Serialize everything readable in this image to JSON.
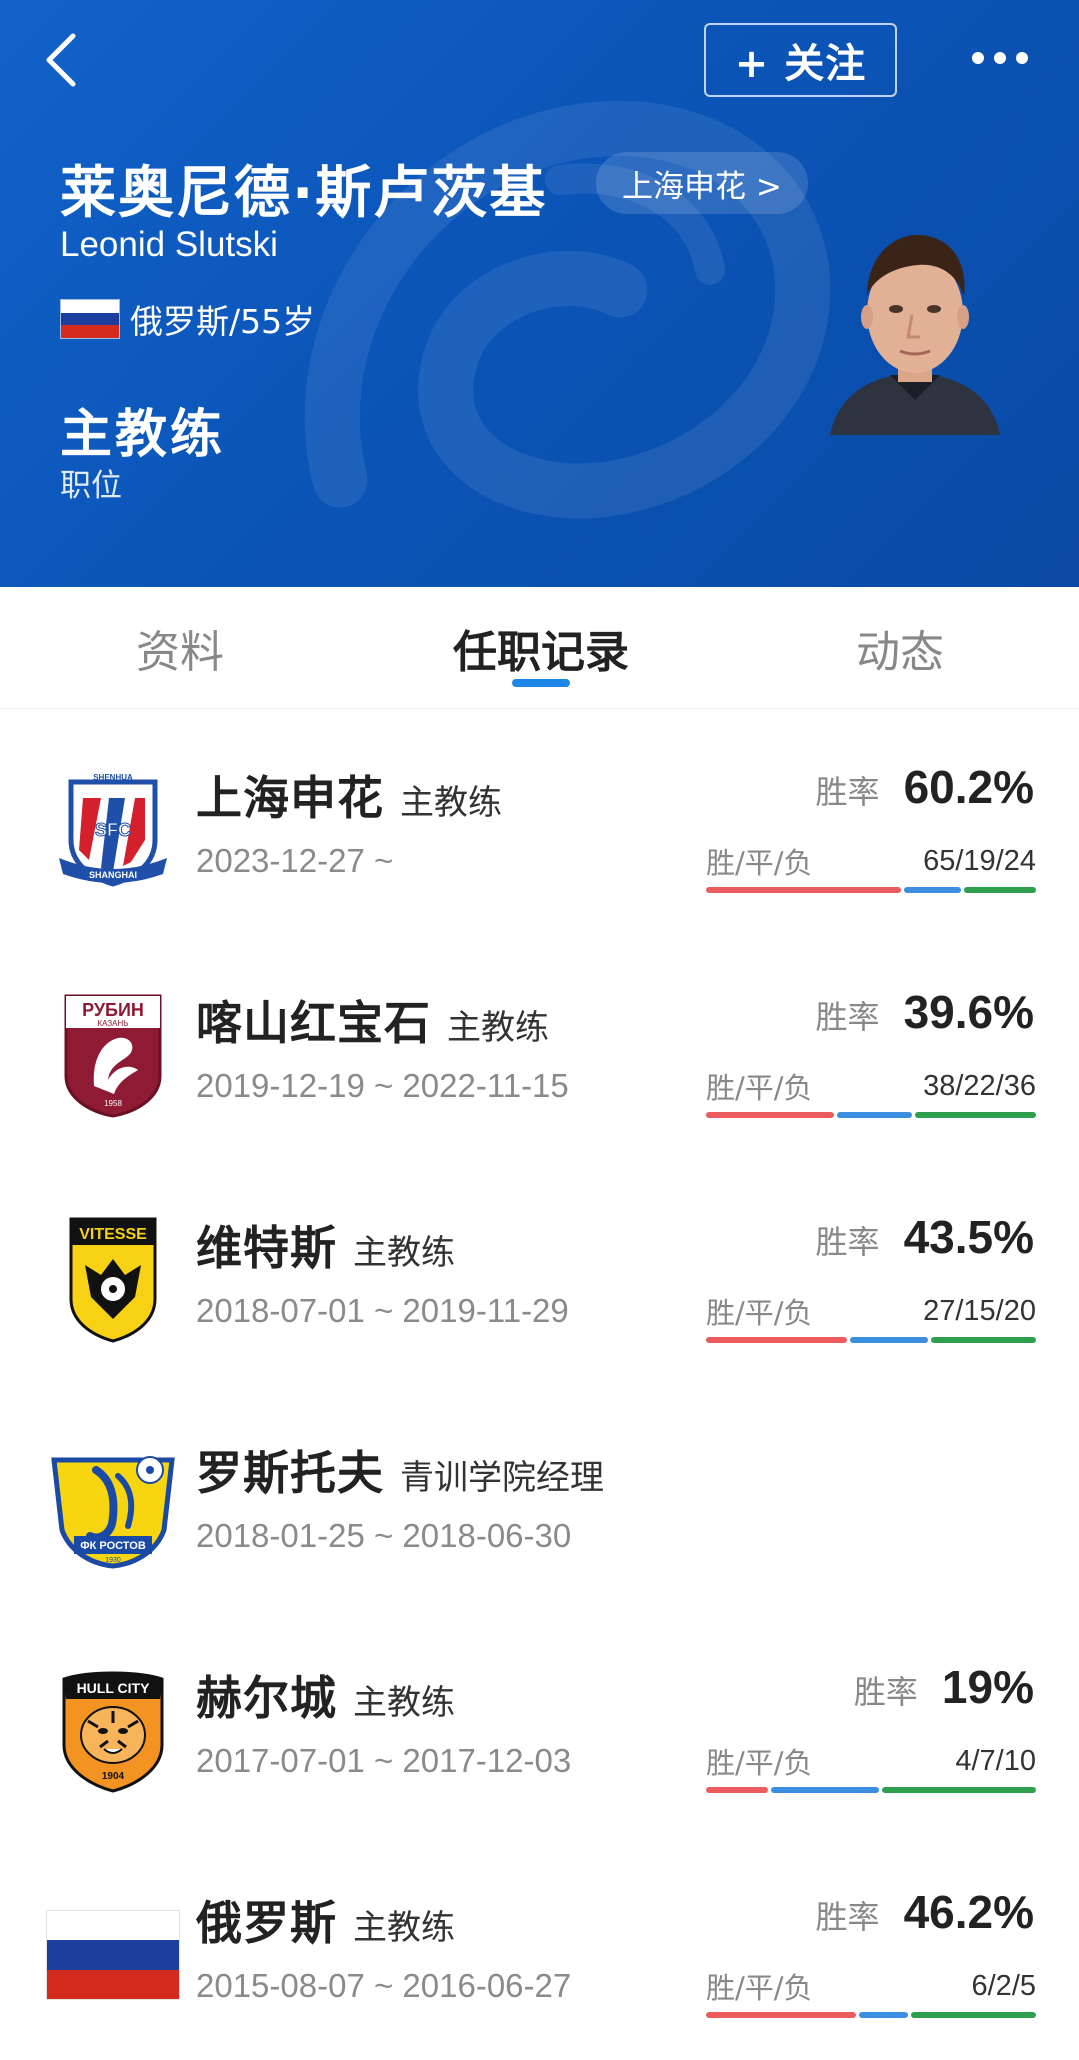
{
  "header": {
    "follow_label": "+ 关注",
    "name_cn": "莱奥尼德·斯卢茨基",
    "team_chip": "上海申花 >",
    "name_en": "Leonid Slutski",
    "nationality_age": "俄罗斯/55岁",
    "role": "主教练",
    "role_caption": "职位"
  },
  "tabs": [
    {
      "label": "资料",
      "active": false
    },
    {
      "label": "任职记录",
      "active": true
    },
    {
      "label": "动态",
      "active": false
    }
  ],
  "career": [
    {
      "club": "上海申花",
      "role": "主教练",
      "period": "2023-12-27 ~",
      "rate_label": "胜率",
      "win_rate": "60.2%",
      "wdl_label": "胜/平/负",
      "wdl": "65/19/24",
      "w": 65,
      "d": 19,
      "l": 24,
      "logo": "shanghai-shenhua-logo"
    },
    {
      "club": "喀山红宝石",
      "role": "主教练",
      "period": "2019-12-19 ~ 2022-11-15",
      "rate_label": "胜率",
      "win_rate": "39.6%",
      "wdl_label": "胜/平/负",
      "wdl": "38/22/36",
      "w": 38,
      "d": 22,
      "l": 36,
      "logo": "rubin-kazan-logo"
    },
    {
      "club": "维特斯",
      "role": "主教练",
      "period": "2018-07-01 ~ 2019-11-29",
      "rate_label": "胜率",
      "win_rate": "43.5%",
      "wdl_label": "胜/平/负",
      "wdl": "27/15/20",
      "w": 27,
      "d": 15,
      "l": 20,
      "logo": "vitesse-logo"
    },
    {
      "club": "罗斯托夫",
      "role": "青训学院经理",
      "period": "2018-01-25 ~ 2018-06-30",
      "logo": "fc-rostov-logo"
    },
    {
      "club": "赫尔城",
      "role": "主教练",
      "period": "2017-07-01 ~ 2017-12-03",
      "rate_label": "胜率",
      "win_rate": "19%",
      "wdl_label": "胜/平/负",
      "wdl": "4/7/10",
      "w": 4,
      "d": 7,
      "l": 10,
      "logo": "hull-city-logo"
    },
    {
      "club": "俄罗斯",
      "role": "主教练",
      "period": "2015-08-07 ~ 2016-06-27",
      "rate_label": "胜率",
      "win_rate": "46.2%",
      "wdl_label": "胜/平/负",
      "wdl": "6/2/5",
      "w": 6,
      "d": 2,
      "l": 5,
      "logo": "russia-flag"
    }
  ],
  "logos": {
    "shenhua_top": "SHENHUA",
    "shenhua_mid": "SFC",
    "shenhua_bottom": "SHANGHAI",
    "rubin_top": "РУБИН",
    "rubin_sub": "КАЗАНЬ",
    "rubin_year": "1958",
    "vitesse_top": "VITESSE",
    "rostov_text": "ФК РОСТОВ",
    "rostov_year": "1930",
    "hull_top": "HULL CITY",
    "hull_year": "1904"
  },
  "colors": {
    "header_blue": "#0b55b8",
    "tab_accent": "#1e86e6",
    "win": "#ec5c5f",
    "draw": "#3c8fe0",
    "loss": "#2e9e4f"
  }
}
